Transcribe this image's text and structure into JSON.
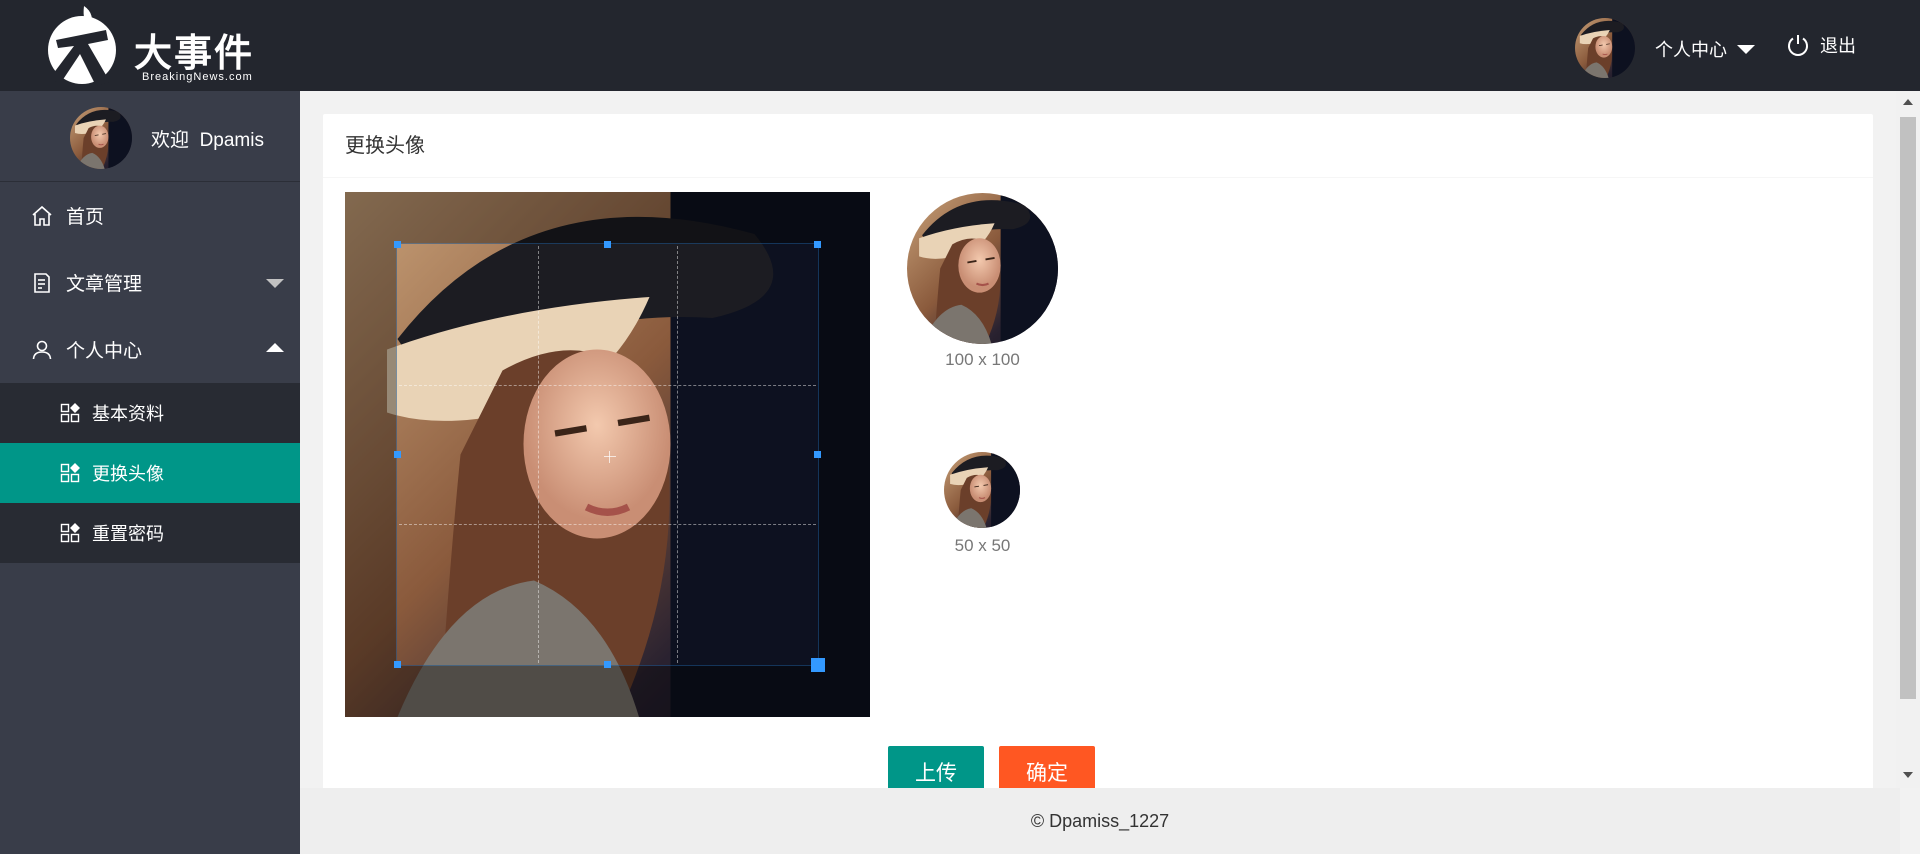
{
  "header": {
    "logo_title": "大事件",
    "logo_subtitle": "BreakingNews.com",
    "user_menu_label": "个人中心",
    "logout_label": "退出"
  },
  "sidebar": {
    "welcome_prefix": "欢迎",
    "username": "Dpamis",
    "items": [
      {
        "label": "首页",
        "icon": "home-icon"
      },
      {
        "label": "文章管理",
        "icon": "article-icon",
        "expanded": false
      },
      {
        "label": "个人中心",
        "icon": "user-icon",
        "expanded": true
      }
    ],
    "sub_items": [
      {
        "label": "基本资料",
        "icon": "app-grid-icon",
        "active": false
      },
      {
        "label": "更换头像",
        "icon": "app-grid-icon",
        "active": true
      },
      {
        "label": "重置密码",
        "icon": "app-grid-icon",
        "active": false
      }
    ]
  },
  "main": {
    "card_title": "更换头像",
    "preview_large_label": "100 x 100",
    "preview_small_label": "50 x 50",
    "upload_button": "上传",
    "confirm_button": "确定"
  },
  "footer": {
    "copyright": "© Dpamiss_1227"
  },
  "colors": {
    "header_bg": "#23262e",
    "sidebar_bg": "#393d49",
    "active_green": "#009688",
    "confirm_orange": "#ff5722",
    "crop_blue": "#3399ff"
  }
}
